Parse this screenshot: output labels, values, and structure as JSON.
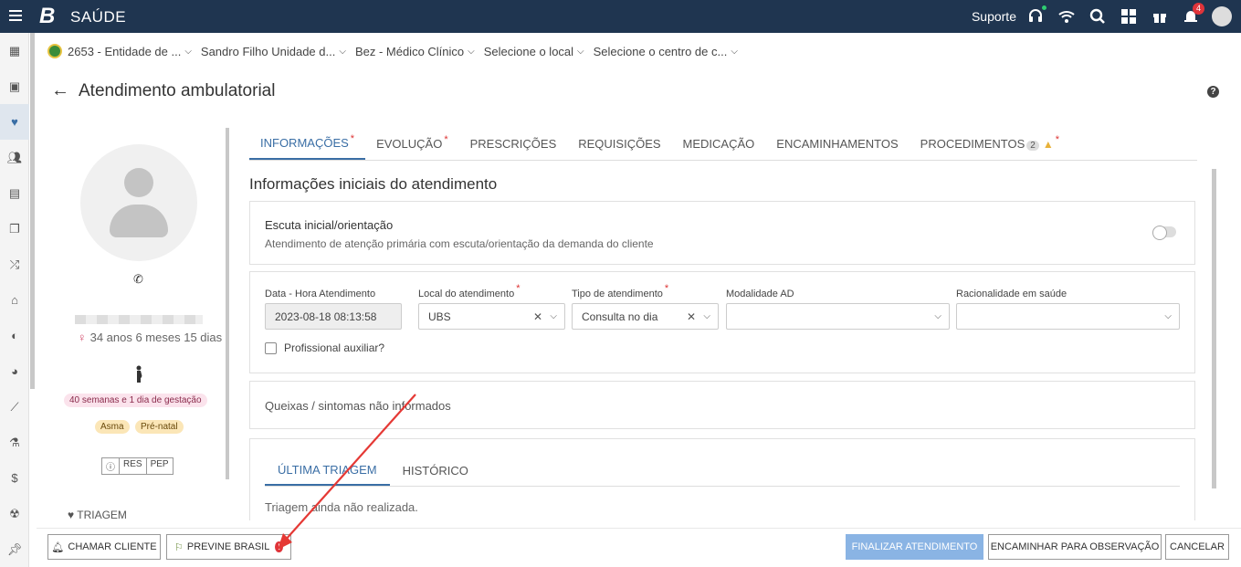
{
  "app": {
    "brand_logo": "B",
    "brand_name": "SAÚDE"
  },
  "topbar": {
    "suporte_label": "Suporte",
    "notifications_count": "4",
    "icons": [
      "headset-icon",
      "wifi-icon",
      "search-icon",
      "dashboard-icon",
      "gift-icon",
      "bell-icon",
      "user-avatar"
    ]
  },
  "sidebar": {
    "items": [
      "dashboard-icon",
      "calendar-icon",
      "heart-pulse-icon",
      "users-icon",
      "boxes-icon",
      "copy-icon",
      "shuffle-icon",
      "home-icon",
      "pills-icon",
      "pie-chart-icon",
      "syringe-icon",
      "flask-icon",
      "dollar-icon",
      "radiation-icon",
      "pin-icon"
    ],
    "active_index": 2
  },
  "context": {
    "entity": "2653 - Entidade de ...",
    "unit": "Sandro Filho Unidade d...",
    "role": "Bez - Médico Clínico",
    "local": "Selecione o local",
    "center": "Selecione o centro de c..."
  },
  "page": {
    "title": "Atendimento ambulatorial",
    "help": "?"
  },
  "patient": {
    "age": "34 anos 6 meses 15 dias",
    "gestation": "40 semanas e 1 dia de gestação",
    "tags": [
      "Asma",
      "Pré-natal"
    ],
    "buttons": [
      "ⓘ",
      "RES",
      "PEP"
    ],
    "triagem_label": "TRIAGEM"
  },
  "tabs": [
    {
      "label": "INFORMAÇÕES",
      "required": true,
      "active": true
    },
    {
      "label": "EVOLUÇÃO",
      "required": true
    },
    {
      "label": "PRESCRIÇÕES"
    },
    {
      "label": "REQUISIÇÕES"
    },
    {
      "label": "MEDICAÇÃO"
    },
    {
      "label": "ENCAMINHAMENTOS"
    },
    {
      "label": "PROCEDIMENTOS",
      "count": "2",
      "warning": true,
      "required": true
    }
  ],
  "required_mark": "*",
  "section": {
    "title": "Informações iniciais do atendimento",
    "escuta_title": "Escuta inicial/orientação",
    "escuta_sub": "Atendimento de atenção primária com escuta/orientação da demanda do cliente"
  },
  "form": {
    "data_hora_label": "Data - Hora Atendimento",
    "data_hora_value": "2023-08-18 08:13:58",
    "local_label": "Local do atendimento",
    "local_value": "UBS",
    "tipo_label": "Tipo de atendimento",
    "tipo_value": "Consulta no dia",
    "modalidade_label": "Modalidade AD",
    "modalidade_value": "",
    "racionalidade_label": "Racionalidade em saúde",
    "racionalidade_value": "",
    "auxiliar_label": "Profissional auxiliar?"
  },
  "queixas_text": "Queixas / sintomas não informados",
  "triagem": {
    "tabs": [
      "ÚLTIMA TRIAGEM",
      "HISTÓRICO"
    ],
    "empty_text": "Triagem ainda não realizada."
  },
  "footer": {
    "chamar": "CHAMAR CLIENTE",
    "previne": "PREVINE BRASIL",
    "finalizar": "FINALIZAR ATENDIMENTO",
    "encaminhar": "ENCAMINHAR PARA OBSERVAÇÃO",
    "cancelar": "CANCELAR"
  },
  "colors": {
    "topbar": "#1f3550",
    "accent": "#3a6ea5",
    "primary_button": "#8ab4e4",
    "annotation_arrow": "#e53935"
  }
}
